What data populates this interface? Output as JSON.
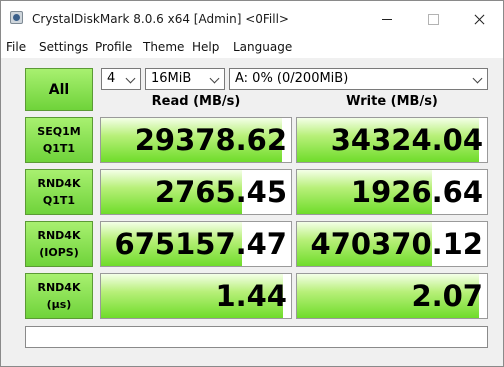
{
  "window": {
    "title": "CrystalDiskMark 8.0.6 x64 [Admin] <0Fill>"
  },
  "menu": {
    "items": [
      "File",
      "Settings",
      "Profile",
      "Theme",
      "Help",
      "Language"
    ]
  },
  "toolbar": {
    "all_label": "All",
    "count_value": "4",
    "size_value": "16MiB",
    "drive_value": "A: 0% (0/200MiB)"
  },
  "headers": {
    "read": "Read (MB/s)",
    "write": "Write (MB/s)"
  },
  "rows": [
    {
      "line1": "SEQ1M",
      "line2": "Q1T1",
      "read": "29378.62",
      "write": "34324.04",
      "read_fill": 0.95,
      "write_fill": 0.96
    },
    {
      "line1": "RND4K",
      "line2": "Q1T1",
      "read": "2765.45",
      "write": "1926.64",
      "read_fill": 0.74,
      "write_fill": 0.71
    },
    {
      "line1": "RND4K",
      "line2": "(IOPS)",
      "read": "675157.47",
      "write": "470370.12",
      "read_fill": 0.74,
      "write_fill": 0.71
    },
    {
      "line1": "RND4K",
      "line2": "(μs)",
      "read": "1.44",
      "write": "2.07",
      "read_fill": 0.96,
      "write_fill": 0.96
    }
  ],
  "comment": "",
  "colors": {
    "button_green": "#7fdc45",
    "bar_green": "#6fdc2a",
    "background": "#f0f0f0"
  }
}
